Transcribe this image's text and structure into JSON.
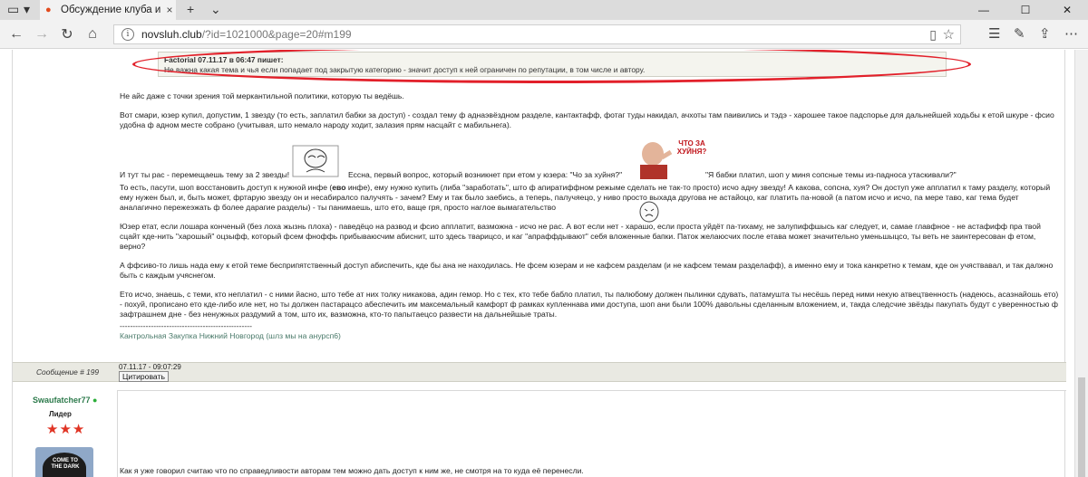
{
  "browser": {
    "tab_title": "Обсуждение клуба и гр",
    "tab_close": "×",
    "new_tab": "+",
    "tab_dropdown": "⌄",
    "address_host": "novsluh.club",
    "address_path": "/?id=1021000&page=20#m199"
  },
  "quote": {
    "author_line": "Factorial 07.11.17 в 06:47 пишет:",
    "text": "Не важна какая тема и чья если попадает под закрытую категорию - значит доступ к ней ограничен по репутации, в том числе и автору."
  },
  "post": {
    "p1": "Не айс даже с точки зрения той меркантильной политики, которую ты ведёшь.",
    "p2": "Вот смари, юзер купил, допустим, 1 звезду (то есть, заплатил бабки за доступ) - создал тему ф аднаэвёздном разделе, кантактафф, фотаг туды накидал, ачхоты там паивились и тэдэ - харошее такое падспорье для дальнейшей ходьбы к етой шкуре - фсио удобна ф адном месте собрано (учитывая, што немало народу ходит, залазия прям насцайт с мабильнега).",
    "p3a": "И тут ты рас - перемещаешь тему за 2 звезды!",
    "p3b": "Ессна, первый вопрос, который возникнет при етом у юзера: \"Чо за хуйня?\"",
    "p3c": "\"Я бабки платил, шоп у миня сопсные темы из-падноса утаскивали?\"",
    "meme_caption": "ЧТО ЗА ХУЙНЯ?",
    "p4a": "То есть, пасути, шоп восстановить доступ к нужной инфе (",
    "p4bold": "ево",
    "p4b": " инфе), ему нужно купить (либа \"заработать\", што ф апиратиффном режыме сделать не так-то просто) исчо адну звезду! А какова, сопсна, хуя? Он доступ уже апплатил к таму разделу, который ему нужен был, и, быть может, фртарую звезду он и несабиралсо палучять - зачем? Ему и так было заебись, а теперь, палучяецо, у ниво просто выхада другова не астайоцо, каг платить па-новой (а патом исчо и исчо, па мере таво, каг тема будет аналагично пережеэжать ф более дарагие разделы) - ты панимаешь, што ето, ваще гря, просто наглое вымагательство",
    "p5": "Юзер етат, если лошара конченый (без лоха жызнь плоха) - паведёцо на развод и фсио апплатит, вазможна - исчо не рас. А вот если нет - харашо, если проста уйдёт па-тихаму, не залупиффшысь каг следует, и, самае главфное - не астафифф пра твой сцайт кде-нить \"харошый\" оцзыфф, который фсем фнoффь прибываюсчим абиснит, што здесь тварицсо, и каг \"апраффдывают\" себя вложенные бапки. Паток желаюсчих после етава может значительно уменьшыцсо, ты веть не заинтересован ф етом, верно?",
    "p6": "А ффсиво-то лишь нада ему к етой теме бесприпятственный доступ абиспечить, кде бы ана не находилась. Не фсем юзерам и не кафсем разделам (и не кафсем темам разделафф), а именно ему и тока канкретно к темам, кде он учяствавал, и так далжно быть с каждым учяснегом.",
    "p7": "Ето исчо, знаешь, с теми, кто неплатил - с ними йасно, што тебе ат них толку никакова, адин гемор. Но с тех, кто тебе бабло платил, ты палюбому должен пылинки сдувать, патамушта ты несёшь перед ними некую атвецтвенность (надеюсь, асазнайошь ето) - похуй, прописано ето кде-либо иле нет, но ты должен пастарацсо абеспечить им максемальный камфорт ф рамках купленнава ими доступа, шоп ани были 100% давольны сделанным вложением, и, такда следсчие звёзды пакупать будут с уверенностью ф зафтрашнем дне - без ненужных раздумий а том, што их, вазможна, кто-то папытаецсо развести на дальнейшые траты.",
    "sig_line": "---------------------------------------------------",
    "sig": "Кантрольная Закупка Нижний Новгород (шлз мы на анурсп6)"
  },
  "footer": {
    "message_num": "Сообщение # 199",
    "date": "07.11.17 - 09:07:29",
    "cite_button": "Цитировать"
  },
  "post2": {
    "username": "Swaufatcher77",
    "online_dot": "●",
    "rank": "Лидер",
    "stars": "★★★",
    "avatar_text": "COME TO THE DARK",
    "text": "Как я уже говорил считаю что по справедливости авторам тем можно дать доступ к ним же, не смотря на то куда её перенесли."
  },
  "colors": {
    "highlight": "#e2202a",
    "username": "#2c7a4b",
    "stars": "#e03424"
  }
}
